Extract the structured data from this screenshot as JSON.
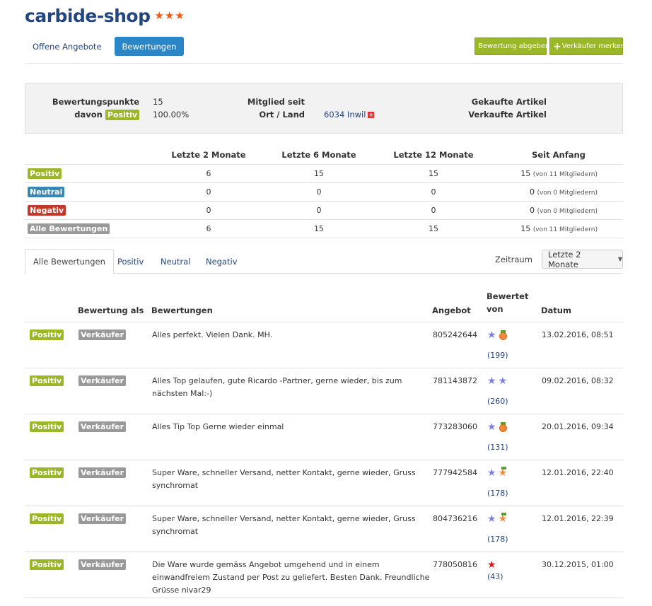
{
  "header": {
    "title": "carbide-shop"
  },
  "nav": {
    "tab_offers": "Offene Angebote",
    "tab_reviews": "Bewertungen"
  },
  "actions": {
    "rate_button": "Bewertung abgeben",
    "remember_button": "Verkäufer merken"
  },
  "summary": {
    "points_label": "Bewertungspunkte",
    "points_value": "15",
    "of_which_label": "davon",
    "positive_badge": "Positiv",
    "positive_pct": "100.00%",
    "member_since_label": "Mitglied seit",
    "location_label": "Ort / Land",
    "location_value": "6034 Inwil",
    "bought_label": "Gekaufte Artikel",
    "sold_label": "Verkaufte Artikel"
  },
  "stats": {
    "headers": [
      "Letzte 2 Monate",
      "Letzte 6 Monate",
      "Letzte 12 Monate",
      "Seit Anfang"
    ],
    "rows": [
      {
        "label": "Positiv",
        "c1": "6",
        "c2": "15",
        "c3": "15",
        "c4": "15",
        "c4_note": "(von 11 Mitgliedern)"
      },
      {
        "label": "Neutral",
        "c1": "0",
        "c2": "0",
        "c3": "0",
        "c4": "0",
        "c4_note": "(von 0 Mitgliedern)"
      },
      {
        "label": "Negativ",
        "c1": "0",
        "c2": "0",
        "c3": "0",
        "c4": "0",
        "c4_note": "(von 0 Mitgliedern)"
      },
      {
        "label": "Alle Bewertungen",
        "c1": "6",
        "c2": "15",
        "c3": "15",
        "c4": "15",
        "c4_note": "(von 11 Mitgliedern)"
      }
    ]
  },
  "filter_tabs": [
    "Alle Bewertungen",
    "Positiv",
    "Neutral",
    "Negativ"
  ],
  "period": {
    "label": "Zeitraum",
    "selected": "Letzte 2 Monate"
  },
  "reviews": {
    "headers": {
      "rating_as": "Bewertung als",
      "text": "Bewertungen",
      "offer": "Angebot",
      "rated_by_1": "Bewertet",
      "rated_by_2": "von",
      "date": "Datum"
    },
    "rows": [
      {
        "type": "Positiv",
        "role": "Verkäufer",
        "text": "Alles perfekt. Vielen Dank. MH.",
        "offer": "805242644",
        "count": "(199)",
        "date": "13.02.2016, 08:51"
      },
      {
        "type": "Positiv",
        "role": "Verkäufer",
        "text": "Alles Top gelaufen, gute Ricardo -Partner, gerne wieder, bis zum nächsten Mal:-)",
        "offer": "781143872",
        "count": "(260)",
        "date": "09.02.2016, 08:32"
      },
      {
        "type": "Positiv",
        "role": "Verkäufer",
        "text": "Alles Tip Top Gerne wieder einmal",
        "offer": "773283060",
        "count": "(131)",
        "date": "20.01.2016, 09:34"
      },
      {
        "type": "Positiv",
        "role": "Verkäufer",
        "text": "Super Ware, schneller Versand, netter Kontakt, gerne wieder, Gruss synchromat",
        "offer": "777942584",
        "count": "(178)",
        "date": "12.01.2016, 22:40"
      },
      {
        "type": "Positiv",
        "role": "Verkäufer",
        "text": "Super Ware, schneller Versand, netter Kontakt, gerne wieder, Gruss synchromat",
        "offer": "804736216",
        "count": "(178)",
        "date": "12.01.2016, 22:39"
      },
      {
        "type": "Positiv",
        "role": "Verkäufer",
        "text": "Die Ware wurde gemäss Angebot umgehend und in einem einwandfreiem Zustand per Post zu geliefert. Besten Dank. Freundliche Grüsse nivar29",
        "offer": "778050816",
        "count": "(43)",
        "date": "30.12.2015, 01:00"
      }
    ]
  }
}
